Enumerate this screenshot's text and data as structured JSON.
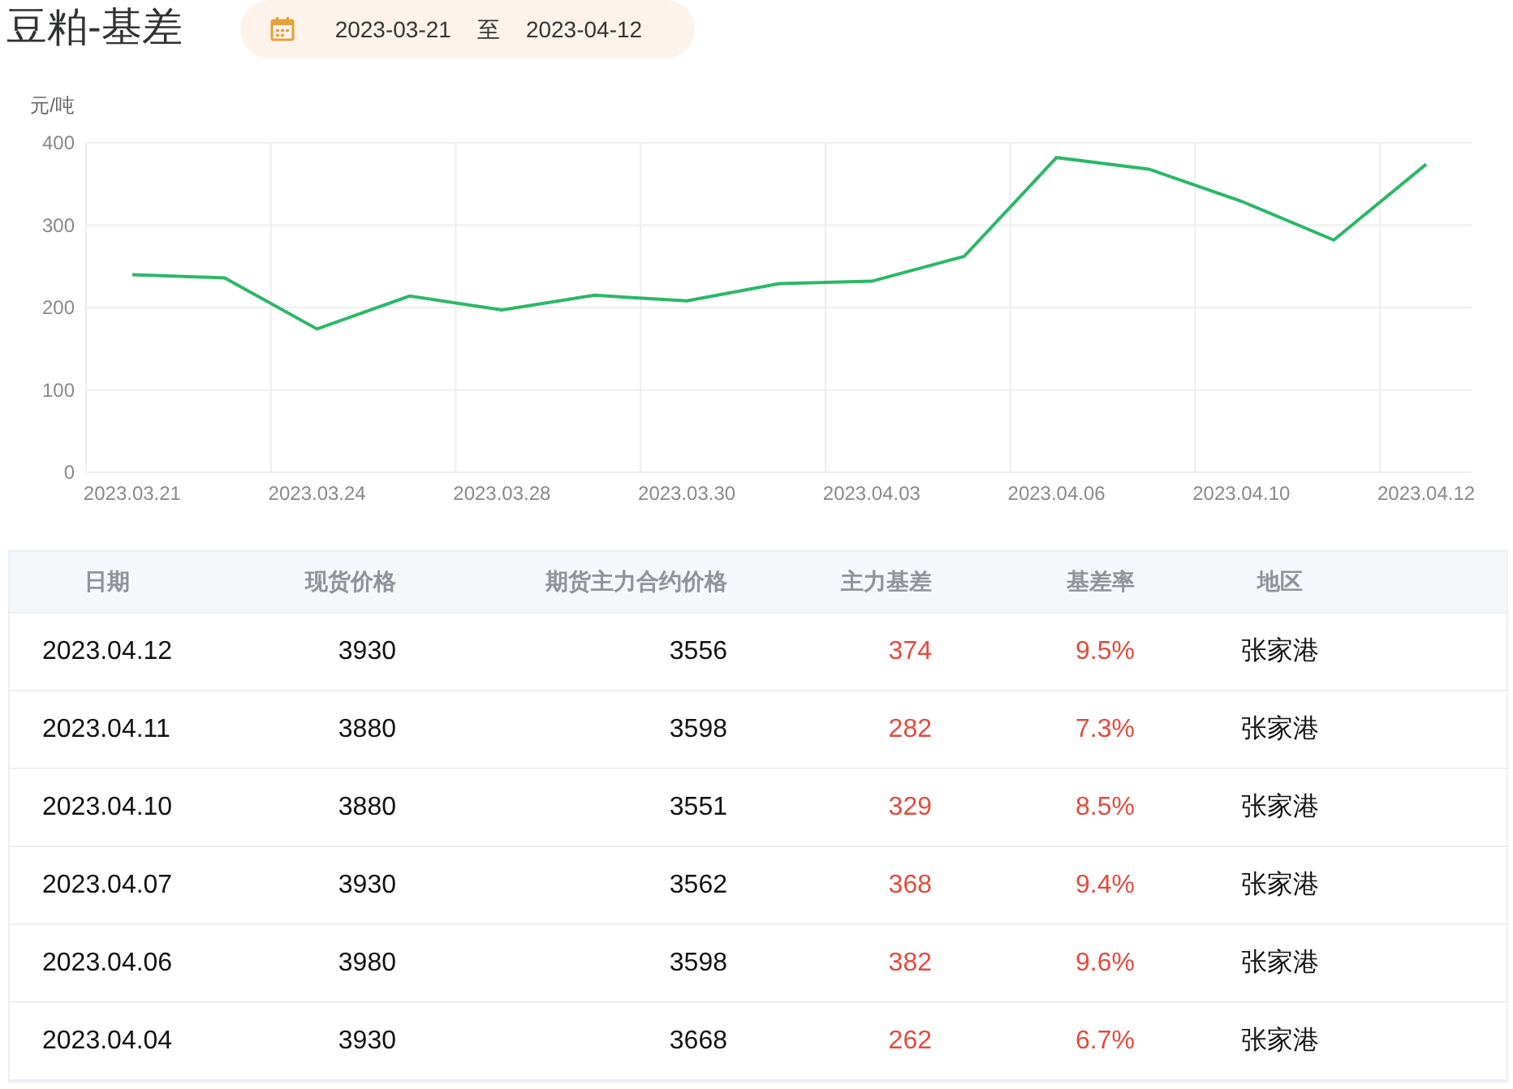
{
  "title": "豆粕-基差",
  "date_range": {
    "start": "2023-03-21",
    "separator": "至",
    "end": "2023-04-12"
  },
  "chart": {
    "chart_data": {
      "type": "line",
      "ylabel": "元/吨",
      "categories": [
        "2023.03.21",
        null,
        "2023.03.24",
        null,
        "2023.03.28",
        null,
        "2023.03.30",
        null,
        "2023.04.03",
        null,
        "2023.04.06",
        null,
        "2023.04.10",
        null,
        "2023.04.12"
      ],
      "ylim": [
        0,
        400
      ],
      "grid": true,
      "yticks": [
        0,
        100,
        200,
        300,
        400
      ],
      "series": [
        {
          "color": "#2bb866",
          "values": [
            240,
            236,
            174,
            214,
            197,
            215,
            208,
            229,
            232,
            262,
            382,
            368,
            329,
            282,
            374
          ]
        }
      ]
    }
  },
  "table": {
    "columns": [
      {
        "label": "日期",
        "kind": "date"
      },
      {
        "label": "现货价格",
        "kind": "number"
      },
      {
        "label": "期货主力合约价格",
        "kind": "number"
      },
      {
        "label": "主力基差",
        "kind": "accent"
      },
      {
        "label": "基差率",
        "kind": "accent"
      },
      {
        "label": "地区",
        "kind": "region"
      }
    ],
    "rows": [
      [
        "2023.04.12",
        "3930",
        "3556",
        "374",
        "9.5%",
        "张家港"
      ],
      [
        "2023.04.11",
        "3880",
        "3598",
        "282",
        "7.3%",
        "张家港"
      ],
      [
        "2023.04.10",
        "3880",
        "3551",
        "329",
        "8.5%",
        "张家港"
      ],
      [
        "2023.04.07",
        "3930",
        "3562",
        "368",
        "9.4%",
        "张家港"
      ],
      [
        "2023.04.06",
        "3980",
        "3598",
        "382",
        "9.6%",
        "张家港"
      ],
      [
        "2023.04.04",
        "3930",
        "3668",
        "262",
        "6.7%",
        "张家港"
      ]
    ]
  }
}
